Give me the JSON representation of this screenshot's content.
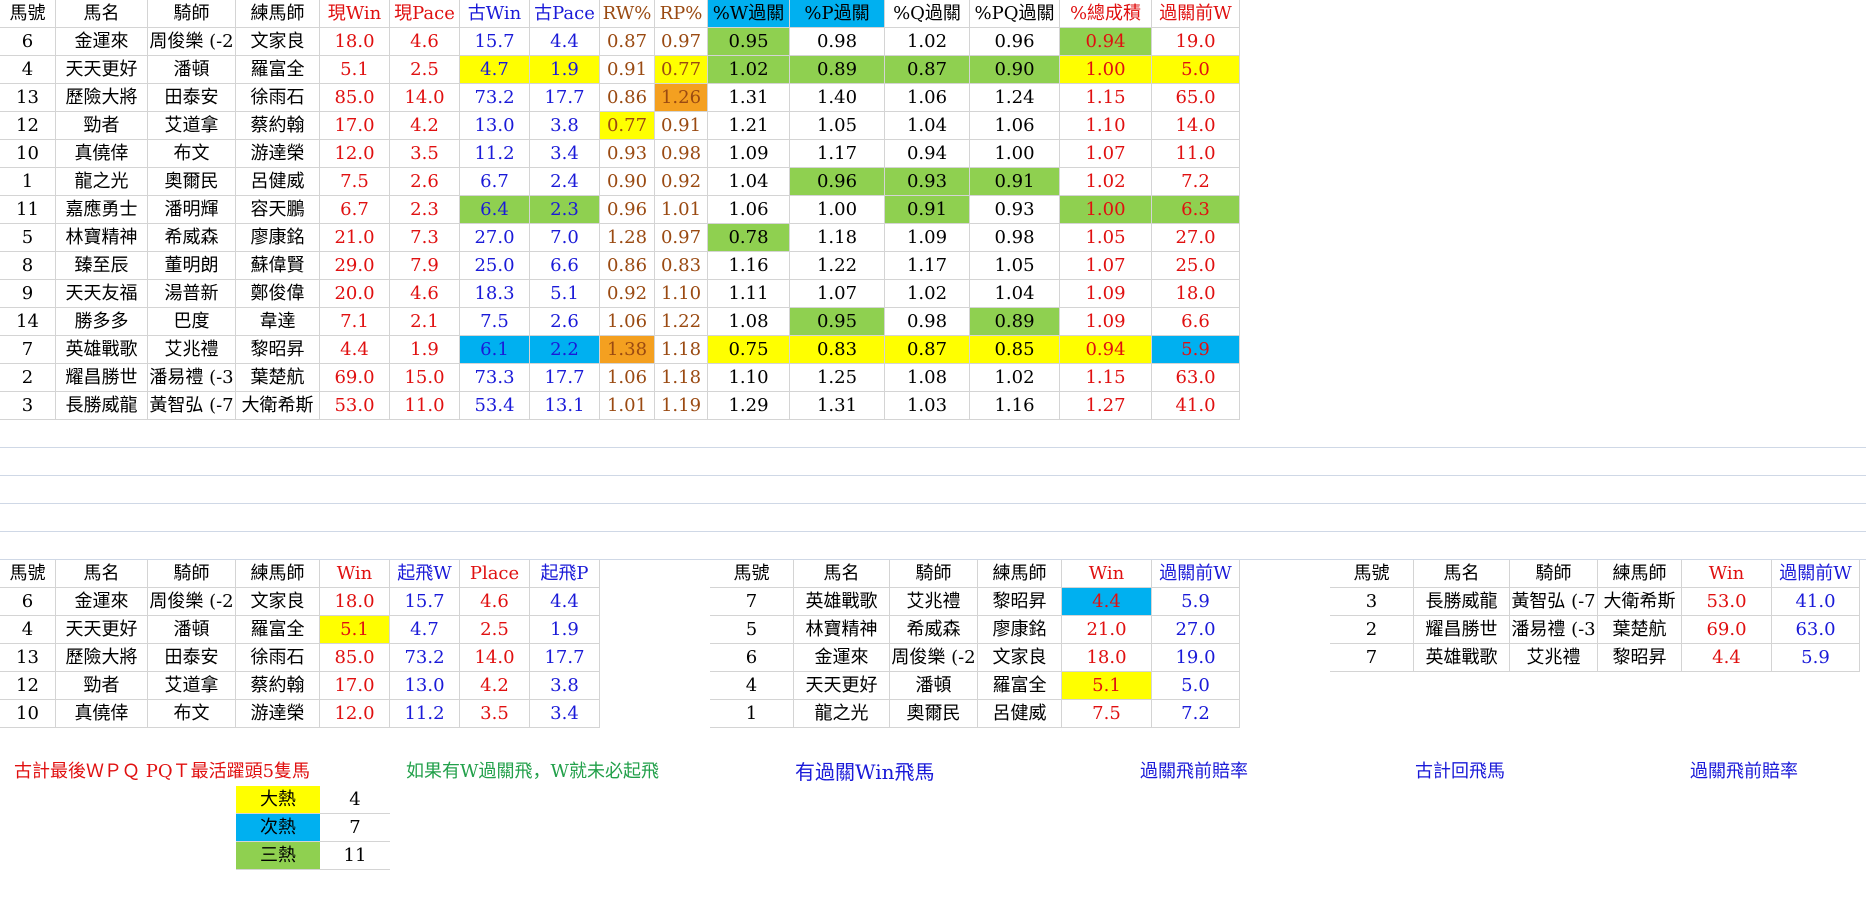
{
  "top": {
    "headers": [
      "馬號",
      "馬名",
      "騎師",
      "練馬師",
      "現Win",
      "現Pace",
      "古Win",
      "古Pace",
      "RW%",
      "RP%",
      "%W過關",
      "%P過關",
      "%Q過關",
      "%PQ過關",
      "%總成積",
      "過關前W"
    ],
    "rows": [
      [
        "6",
        "金運來",
        "周俊樂 (-2",
        "文家良",
        "18.0",
        "4.6",
        "15.7",
        "4.4",
        "0.87",
        "0.97",
        "0.95",
        "0.98",
        "1.02",
        "0.96",
        "0.94",
        "19.0"
      ],
      [
        "4",
        "天天更好",
        "潘頓",
        "羅富全",
        "5.1",
        "2.5",
        "4.7",
        "1.9",
        "0.91",
        "0.77",
        "1.02",
        "0.89",
        "0.87",
        "0.90",
        "1.00",
        "5.0"
      ],
      [
        "13",
        "歷險大將",
        "田泰安",
        "徐雨石",
        "85.0",
        "14.0",
        "73.2",
        "17.7",
        "0.86",
        "1.26",
        "1.31",
        "1.40",
        "1.06",
        "1.24",
        "1.15",
        "65.0"
      ],
      [
        "12",
        "勁者",
        "艾道拿",
        "蔡約翰",
        "17.0",
        "4.2",
        "13.0",
        "3.8",
        "0.77",
        "0.91",
        "1.21",
        "1.05",
        "1.04",
        "1.06",
        "1.10",
        "14.0"
      ],
      [
        "10",
        "真僥倖",
        "布文",
        "游達榮",
        "12.0",
        "3.5",
        "11.2",
        "3.4",
        "0.93",
        "0.98",
        "1.09",
        "1.17",
        "0.94",
        "1.00",
        "1.07",
        "11.0"
      ],
      [
        "1",
        "龍之光",
        "奧爾民",
        "呂健威",
        "7.5",
        "2.6",
        "6.7",
        "2.4",
        "0.90",
        "0.92",
        "1.04",
        "0.96",
        "0.93",
        "0.91",
        "1.02",
        "7.2"
      ],
      [
        "11",
        "嘉應勇士",
        "潘明輝",
        "容天鵬",
        "6.7",
        "2.3",
        "6.4",
        "2.3",
        "0.96",
        "1.01",
        "1.06",
        "1.00",
        "0.91",
        "0.93",
        "1.00",
        "6.3"
      ],
      [
        "5",
        "林寶精神",
        "希威森",
        "廖康銘",
        "21.0",
        "7.3",
        "27.0",
        "7.0",
        "1.28",
        "0.97",
        "0.78",
        "1.18",
        "1.09",
        "0.98",
        "1.05",
        "27.0"
      ],
      [
        "8",
        "臻至辰",
        "董明朗",
        "蘇偉賢",
        "29.0",
        "7.9",
        "25.0",
        "6.6",
        "0.86",
        "0.83",
        "1.16",
        "1.22",
        "1.17",
        "1.05",
        "1.07",
        "25.0"
      ],
      [
        "9",
        "天天友福",
        "湯普新",
        "鄭俊偉",
        "20.0",
        "4.6",
        "18.3",
        "5.1",
        "0.92",
        "1.10",
        "1.11",
        "1.07",
        "1.02",
        "1.04",
        "1.09",
        "18.0"
      ],
      [
        "14",
        "勝多多",
        "巴度",
        "韋達",
        "7.1",
        "2.1",
        "7.5",
        "2.6",
        "1.06",
        "1.22",
        "1.08",
        "0.95",
        "0.98",
        "0.89",
        "1.09",
        "6.6"
      ],
      [
        "7",
        "英雄戰歌",
        "艾兆禮",
        "黎昭昇",
        "4.4",
        "1.9",
        "6.1",
        "2.2",
        "1.38",
        "1.18",
        "0.75",
        "0.83",
        "0.87",
        "0.85",
        "0.94",
        "5.9"
      ],
      [
        "2",
        "耀昌勝世",
        "潘易禮 (-3",
        "葉楚航",
        "69.0",
        "15.0",
        "73.3",
        "17.7",
        "1.06",
        "1.18",
        "1.10",
        "1.25",
        "1.08",
        "1.02",
        "1.15",
        "63.0"
      ],
      [
        "3",
        "長勝威龍",
        "黃智弘 (-7",
        "大衛希斯",
        "53.0",
        "11.0",
        "53.4",
        "13.1",
        "1.01",
        "1.19",
        "1.29",
        "1.31",
        "1.03",
        "1.16",
        "1.27",
        "41.0"
      ]
    ],
    "highlights": {
      "1": {
        "6": "y",
        "7": "y",
        "9": "y",
        "10": "g",
        "11": "g",
        "12": "g",
        "13": "g",
        "14": "y",
        "15": "y"
      },
      "0": {
        "10": "g",
        "14": "g"
      },
      "2": {
        "9": "o"
      },
      "3": {
        "8": "y"
      },
      "5": {
        "11": "g",
        "12": "g",
        "13": "g"
      },
      "6": {
        "6": "g",
        "7": "g",
        "12": "g",
        "14": "g",
        "15": "g"
      },
      "7": {
        "10": "g"
      },
      "10": {
        "11": "g",
        "13": "g"
      },
      "11": {
        "6": "b",
        "7": "b",
        "8": "o",
        "10": "y",
        "11": "y",
        "12": "y",
        "13": "y",
        "14": "y",
        "15": "b"
      }
    }
  },
  "bottom_left": {
    "headers": [
      "馬號",
      "馬名",
      "騎師",
      "練馬師",
      "Win",
      "起飛W",
      "Place",
      "起飛P"
    ],
    "rows": [
      [
        "6",
        "金運來",
        "周俊樂 (-2",
        "文家良",
        "18.0",
        "15.7",
        "4.6",
        "4.4"
      ],
      [
        "4",
        "天天更好",
        "潘頓",
        "羅富全",
        "5.1",
        "4.7",
        "2.5",
        "1.9"
      ],
      [
        "13",
        "歷險大將",
        "田泰安",
        "徐雨石",
        "85.0",
        "73.2",
        "14.0",
        "17.7"
      ],
      [
        "12",
        "勁者",
        "艾道拿",
        "蔡約翰",
        "17.0",
        "13.0",
        "4.2",
        "3.8"
      ],
      [
        "10",
        "真僥倖",
        "布文",
        "游達榮",
        "12.0",
        "11.2",
        "3.5",
        "3.4"
      ]
    ]
  },
  "bottom_mid": {
    "headers": [
      "馬號",
      "馬名",
      "騎師",
      "練馬師",
      "Win",
      "過關前W"
    ],
    "rows": [
      [
        "7",
        "英雄戰歌",
        "艾兆禮",
        "黎昭昇",
        "4.4",
        "5.9"
      ],
      [
        "5",
        "林寶精神",
        "希威森",
        "廖康銘",
        "21.0",
        "27.0"
      ],
      [
        "6",
        "金運來",
        "周俊樂 (-2",
        "文家良",
        "18.0",
        "19.0"
      ],
      [
        "4",
        "天天更好",
        "潘頓",
        "羅富全",
        "5.1",
        "5.0"
      ],
      [
        "1",
        "龍之光",
        "奧爾民",
        "呂健威",
        "7.5",
        "7.2"
      ]
    ]
  },
  "bottom_right": {
    "headers": [
      "馬號",
      "馬名",
      "騎師",
      "練馬師",
      "Win",
      "過關前W"
    ],
    "rows": [
      [
        "3",
        "長勝威龍",
        "黃智弘 (-7",
        "大衛希斯",
        "53.0",
        "41.0"
      ],
      [
        "2",
        "耀昌勝世",
        "潘易禮 (-3",
        "葉楚航",
        "69.0",
        "63.0"
      ],
      [
        "7",
        "英雄戰歌",
        "艾兆禮",
        "黎昭昇",
        "4.4",
        "5.9"
      ]
    ]
  },
  "notes": {
    "n1": "古計最後ＷＰＱ PQＴ最活躍頭5隻馬",
    "n2": "如果有W過關飛，W就未必起飛",
    "n3": "有過關Win飛馬",
    "n4": "過關飛前賠率",
    "n5": "古計回飛馬",
    "n6": "過關飛前賠率"
  },
  "legend": [
    {
      "label": "大熱",
      "value": "4",
      "color": "#ffff00"
    },
    {
      "label": "次熱",
      "value": "7",
      "color": "#00b0f0"
    },
    {
      "label": "三熱",
      "value": "11",
      "color": "#8fd050"
    }
  ]
}
